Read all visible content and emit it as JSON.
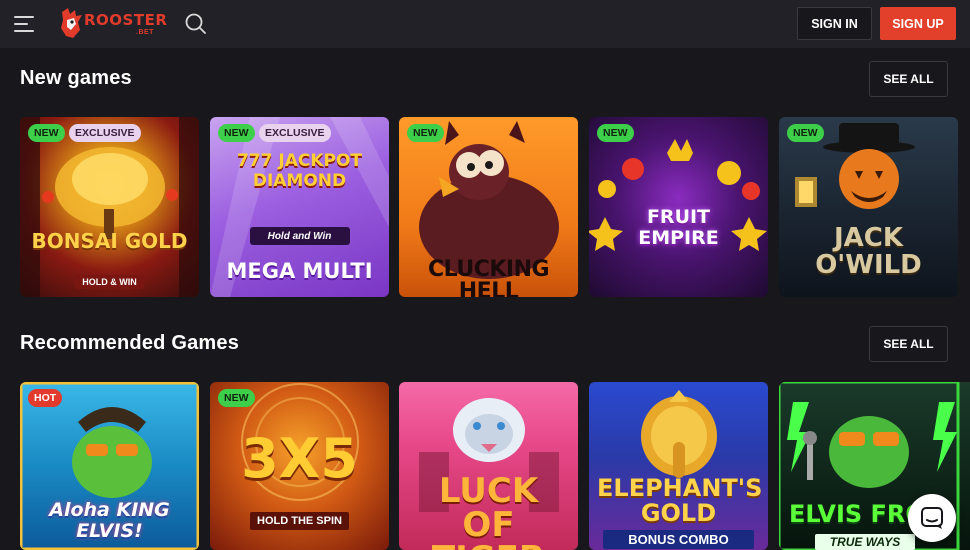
{
  "header": {
    "logo_text": "ROOSTER",
    "logo_sub": ".BET",
    "sign_in_label": "SIGN IN",
    "sign_up_label": "SIGN UP",
    "menu_icon": "hamburger-menu-icon",
    "search_icon": "search-icon"
  },
  "new_games": {
    "title": "New games",
    "see_all_label": "SEE ALL",
    "tiles": [
      {
        "badges": [
          "NEW",
          "EXCLUSIVE"
        ],
        "name": "BONSAI GOLD",
        "sub": "HOLD & WIN"
      },
      {
        "badges": [
          "NEW",
          "EXCLUSIVE"
        ],
        "name": "777 JACKPOT DIAMOND",
        "sub": "Hold and Win",
        "name2": "MEGA MULTI"
      },
      {
        "badges": [
          "NEW"
        ],
        "name": "CLUCKING HELL"
      },
      {
        "badges": [
          "NEW"
        ],
        "name": "FRUIT EMPIRE"
      },
      {
        "badges": [
          "NEW"
        ],
        "name": "JACK O'WILD"
      }
    ]
  },
  "recommended": {
    "title": "Recommended Games",
    "see_all_label": "SEE ALL",
    "tiles": [
      {
        "badges": [
          "HOT"
        ],
        "name": "Aloha KING ELVIS!"
      },
      {
        "badges": [
          "NEW"
        ],
        "name": "3X5",
        "sub": "HOLD THE SPIN"
      },
      {
        "badges": [],
        "name": "LUCK OF TIGER"
      },
      {
        "badges": [],
        "name": "ELEPHANT'S GOLD",
        "sub": "BONUS COMBO"
      },
      {
        "badges": [],
        "name": "ELVIS FRO",
        "sub": "TRUE WAYS"
      }
    ]
  },
  "colors": {
    "background": "#18171c",
    "topbar": "#222128",
    "accent_red": "#e2402a",
    "badge_new": "#3ecf4a",
    "badge_exclusive": "#e8d2ee",
    "badge_hot": "#e23a2c"
  },
  "chat_icon": "chat-bubble-icon"
}
